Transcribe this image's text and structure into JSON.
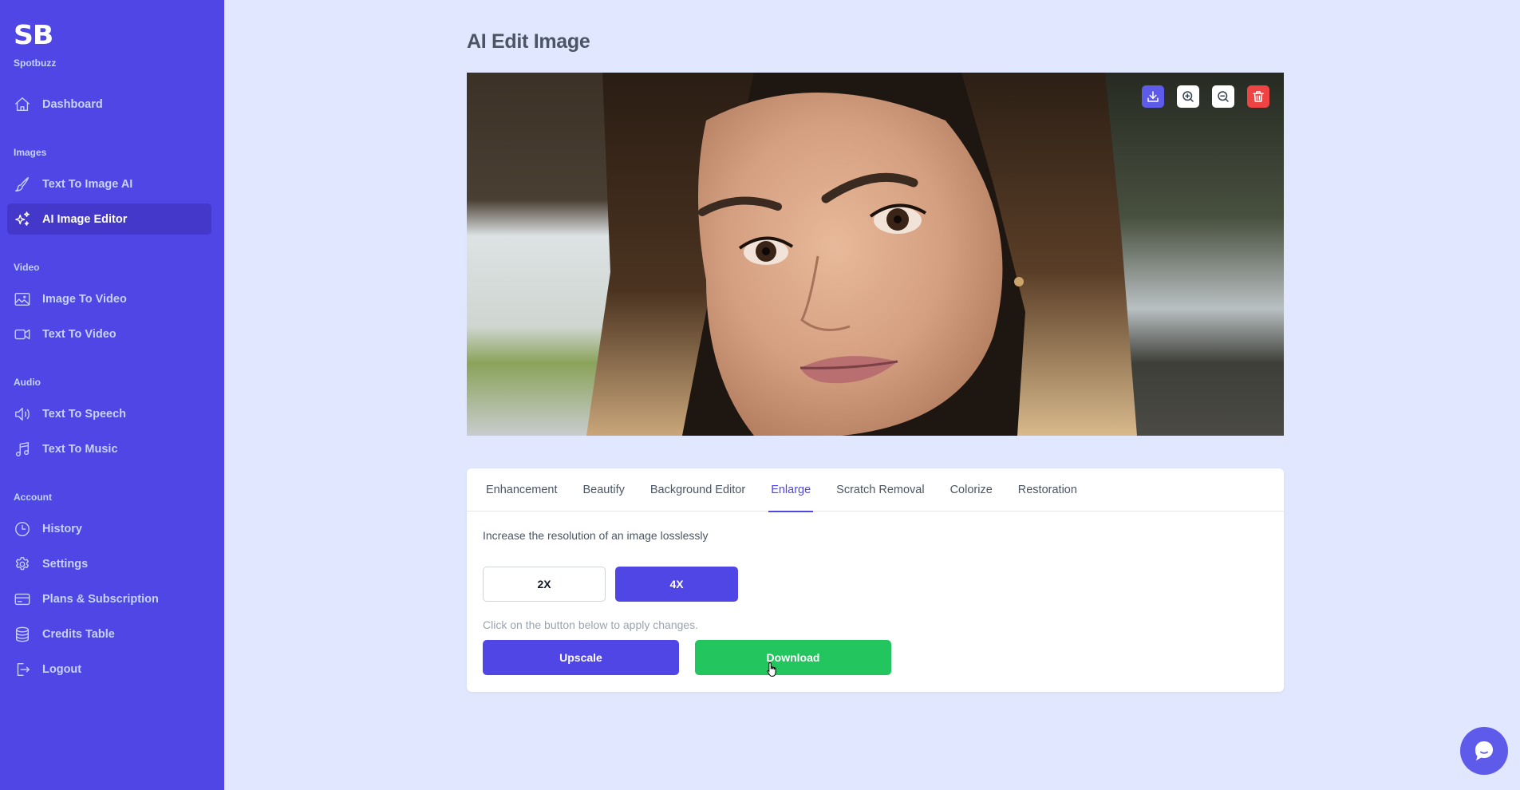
{
  "brand": {
    "logo": "SB",
    "name": "Spotbuzz"
  },
  "sidebar": {
    "top_items": [
      {
        "label": "Dashboard",
        "icon": "home-icon",
        "active": false
      }
    ],
    "sections": [
      {
        "label": "Images",
        "items": [
          {
            "label": "Text To Image AI",
            "icon": "paintbrush-icon",
            "active": false
          },
          {
            "label": "AI Image Editor",
            "icon": "sparkles-icon",
            "active": true
          }
        ]
      },
      {
        "label": "Video",
        "items": [
          {
            "label": "Image To Video",
            "icon": "image-icon",
            "active": false
          },
          {
            "label": "Text To Video",
            "icon": "video-camera-icon",
            "active": false
          }
        ]
      },
      {
        "label": "Audio",
        "items": [
          {
            "label": "Text To Speech",
            "icon": "speaker-icon",
            "active": false
          },
          {
            "label": "Text To Music",
            "icon": "music-note-icon",
            "active": false
          }
        ]
      },
      {
        "label": "Account",
        "items": [
          {
            "label": "History",
            "icon": "clock-icon",
            "active": false
          },
          {
            "label": "Settings",
            "icon": "gear-icon",
            "active": false
          },
          {
            "label": "Plans & Subscription",
            "icon": "credit-card-icon",
            "active": false
          },
          {
            "label": "Credits Table",
            "icon": "database-icon",
            "active": false
          },
          {
            "label": "Logout",
            "icon": "logout-icon",
            "active": false
          }
        ]
      }
    ]
  },
  "main": {
    "title": "AI Edit Image",
    "image_toolbar": [
      {
        "name": "download-image-button",
        "icon": "download-icon"
      },
      {
        "name": "zoom-in-button",
        "icon": "zoom-in-icon"
      },
      {
        "name": "zoom-out-button",
        "icon": "zoom-out-icon"
      },
      {
        "name": "delete-image-button",
        "icon": "trash-icon"
      }
    ],
    "tabs": [
      {
        "label": "Enhancement",
        "active": false
      },
      {
        "label": "Beautify",
        "active": false
      },
      {
        "label": "Background Editor",
        "active": false
      },
      {
        "label": "Enlarge",
        "active": true
      },
      {
        "label": "Scratch Removal",
        "active": false
      },
      {
        "label": "Colorize",
        "active": false
      },
      {
        "label": "Restoration",
        "active": false
      }
    ],
    "enlarge": {
      "description": "Increase the resolution of an image losslessly",
      "scale_options": [
        {
          "label": "2X",
          "selected": false
        },
        {
          "label": "4X",
          "selected": true
        }
      ],
      "hint": "Click on the button below to apply changes.",
      "upscale_label": "Upscale",
      "download_label": "Download"
    }
  },
  "colors": {
    "sidebar_bg": "#4f46e5",
    "active_item_bg": "#4338ca",
    "page_bg": "#e0e7ff",
    "primary": "#4f46e5",
    "success": "#22c55e",
    "danger": "#ef4444"
  }
}
